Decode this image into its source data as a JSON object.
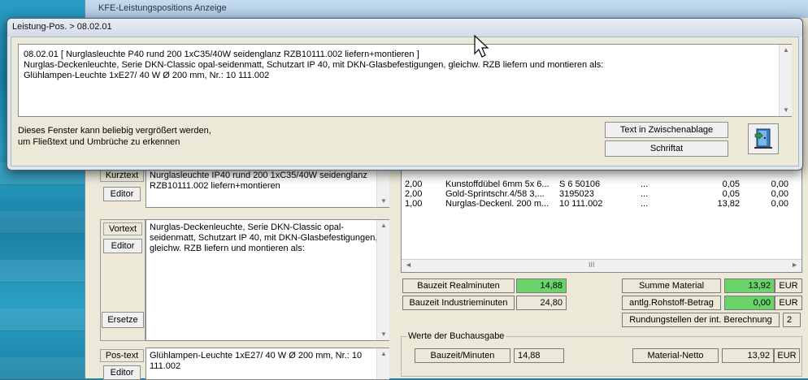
{
  "back_window": {
    "title": "KFE-Leistungspositions Anzeige"
  },
  "dialog": {
    "title": "Leistung-Pos. > 08.02.01",
    "text_lines": [
      "08.02.01 [ Nurglasleuchte  P40 rund 200 1xC35/40W seidenglanz RZB10111.002 liefern+montieren ]",
      "Nurglas-Deckenleuchte, Serie DKN-Classic opal-seidenmatt, Schutzart IP 40, mit DKN-Glasbefestigungen, gleichw. RZB liefern und montieren als:",
      "Glühlampen-Leuchte 1xE27/ 40 W Ø 200 mm, Nr.: 10 111.002"
    ],
    "hint_lines": [
      "Dieses Fenster kann beliebig vergrößert werden,",
      "um Fließtext und Umbrüche zu erkennen"
    ],
    "copy_button": "Text in Zwischenablage",
    "font_button": "Schriftat"
  },
  "left": {
    "kurztext_label": "Kurztext",
    "kurztext_editor": "Editor",
    "kurztext_text": "Nurglasleuchte IP40 rund 200 1xC35/40W seidenglanz RZB10111.002 liefern+montieren",
    "vortext_label": "Vortext",
    "vortext_editor": "Editor",
    "vortext_text": "Nurglas-Deckenleuchte, Serie DKN-Classic opal-seidenmatt, Schutzart IP 40, mit DKN-Glasbefestigungen, gleichw. RZB liefern und montieren als:",
    "ersetze_button": "Ersetze",
    "posttext_label": "Pos-text",
    "posttext_editor": "Editor",
    "posttext_text": "Glühlampen-Leuchte 1xE27/ 40 W Ø 200 mm, Nr.: 10 111.002"
  },
  "material_table": {
    "rows": [
      [
        "2,00",
        "Kunstoffdübel 6mm 5x 6...",
        "S  6 50106",
        "...",
        "0,05",
        "0,00"
      ],
      [
        "2,00",
        "Gold-Sprintschr.4/58 3,...",
        "3195023",
        "...",
        "0,05",
        "0,00"
      ],
      [
        "1,00",
        "Nurglas-Deckenl. 200 m...",
        "10 111.002",
        "...",
        "13,82",
        "0,00"
      ]
    ],
    "hscroll_mark": "III"
  },
  "totals": {
    "bauzeit_real_label": "Bauzeit Realminuten",
    "bauzeit_real_value": "14,88",
    "bauzeit_ind_label": "Bauzeit Industrieminuten",
    "bauzeit_ind_value": "24,80",
    "summe_material_label": "Summe Material",
    "summe_material_value": "13,92",
    "summe_material_unit": "EUR",
    "rohstoff_label": "antlg.Rohstoff-Betrag",
    "rohstoff_value": "0,00",
    "rohstoff_unit": "EUR",
    "rundung_label": "Rundungstellen der int. Berechnung",
    "rundung_value": "2"
  },
  "buchausgabe": {
    "title": "Werte der Buchausgabe",
    "bauzeit_label": "Bauzeit/Minuten",
    "bauzeit_value": "14,88",
    "material_label": "Material-Netto",
    "material_value": "13,92",
    "material_unit": "EUR"
  }
}
